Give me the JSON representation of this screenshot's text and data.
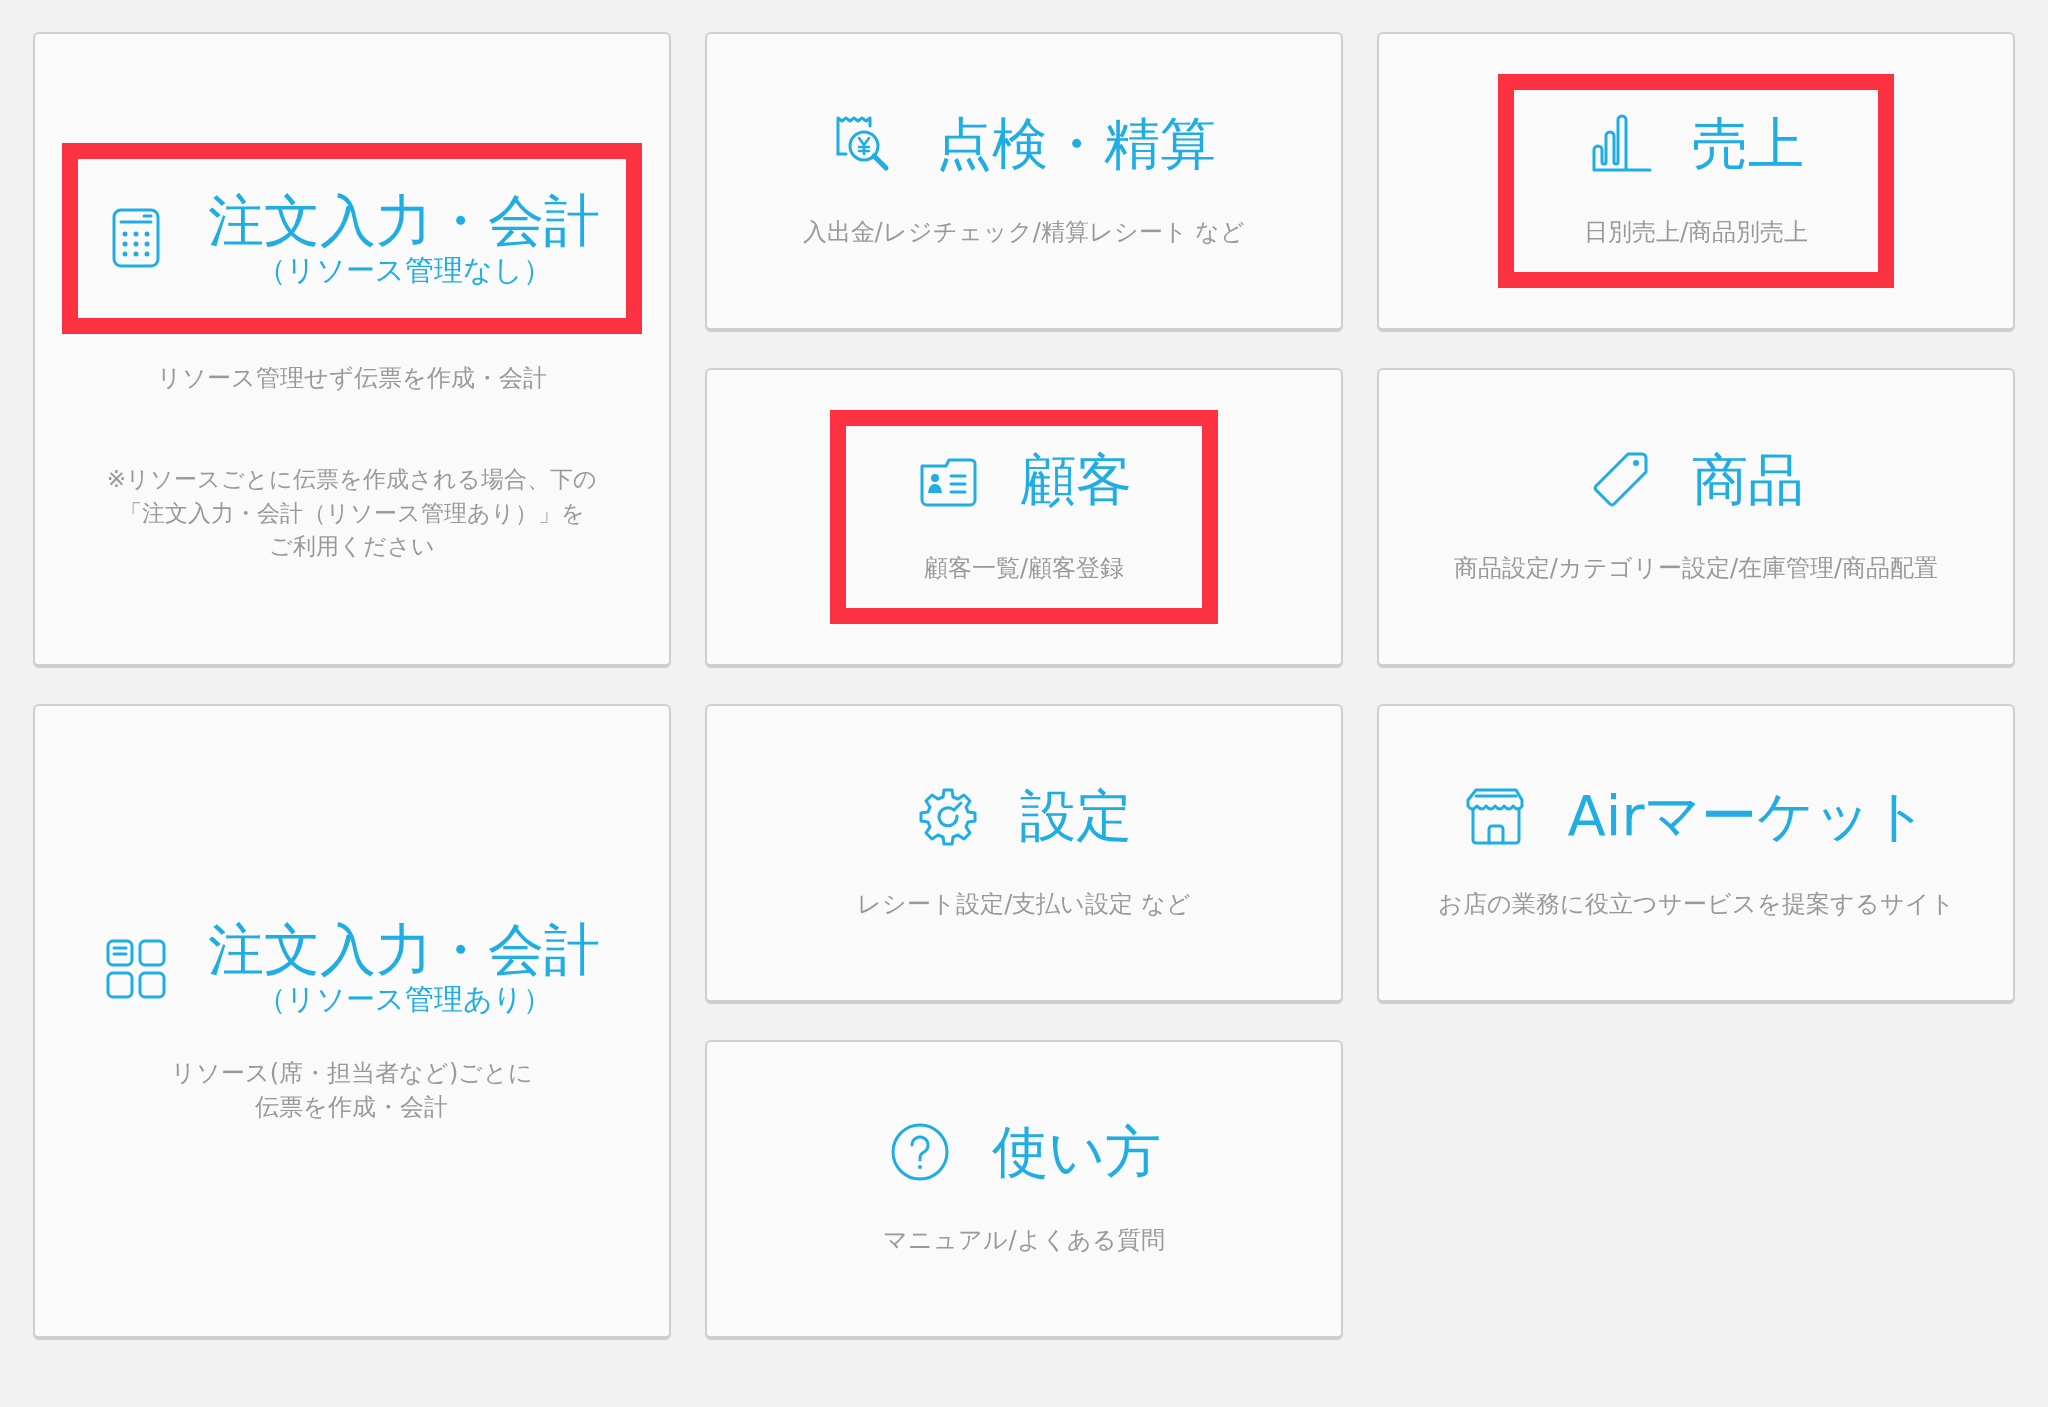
{
  "columns": [
    [
      {
        "highlighted": true,
        "title": "注文入力・会計",
        "subtitle": "（リソース管理なし）",
        "description": [
          "リソース管理せず伝票を作成・会計"
        ],
        "note": [
          "※リソースごとに伝票を作成される場合、下の",
          "「注文入力・会計（リソース管理あり）」を",
          "ご利用ください"
        ]
      },
      {
        "highlighted": false,
        "title": "注文入力・会計",
        "subtitle": "（リソース管理あり）",
        "description": [
          "リソース(席・担当者など)ごとに",
          "伝票を作成・会計"
        ]
      }
    ],
    [
      {
        "highlighted": false,
        "title": "点検・精算",
        "description": [
          "入出金/レジチェック/精算レシート など"
        ]
      },
      {
        "highlighted": true,
        "title": "顧客",
        "description": [
          "顧客一覧/顧客登録"
        ]
      },
      {
        "highlighted": false,
        "title": "設定",
        "description": [
          "レシート設定/支払い設定 など"
        ]
      },
      {
        "highlighted": false,
        "title": "使い方",
        "description": [
          "マニュアル/よくある質問"
        ]
      }
    ],
    [
      {
        "highlighted": true,
        "title": "売上",
        "description": [
          "日別売上/商品別売上"
        ]
      },
      {
        "highlighted": false,
        "title": "商品",
        "description": [
          "商品設定/カテゴリー設定/在庫管理/商品配置"
        ]
      },
      {
        "highlighted": false,
        "title": "Airマーケット",
        "description": [
          "お店の業務に役立つサービスを提案するサイト"
        ]
      }
    ]
  ]
}
